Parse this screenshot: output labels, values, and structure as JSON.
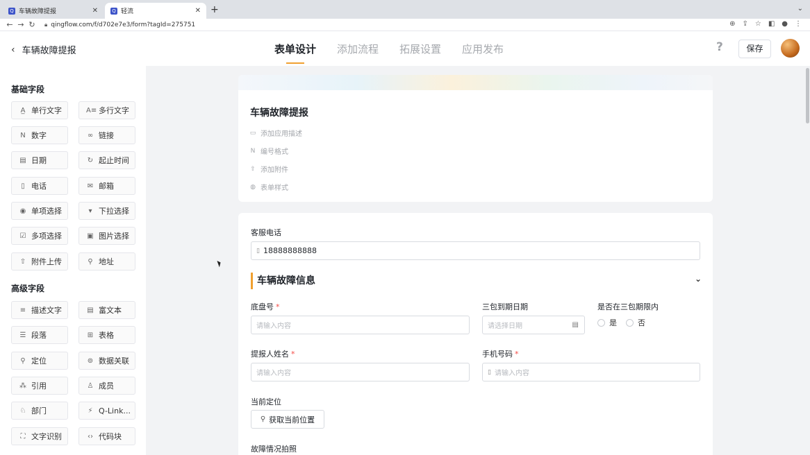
{
  "browser": {
    "tabs": [
      {
        "title": "车辆故障提报",
        "favicon": "Q",
        "active": false
      },
      {
        "title": "轻流",
        "favicon": "Q",
        "active": true
      }
    ],
    "url": "qingflow.com/f/d702e7e3/form?tagId=275751"
  },
  "header": {
    "back_label": "车辆故障提报",
    "tabs": [
      "表单设计",
      "添加流程",
      "拓展设置",
      "应用发布"
    ],
    "active_tab": "表单设计",
    "help": "?",
    "save_label": "保存"
  },
  "sidebar": {
    "basic_title": "基础字段",
    "basic_fields": [
      {
        "label": "单行文字",
        "icon": "single-line-text-icon",
        "glyph": "A̲"
      },
      {
        "label": "多行文字",
        "icon": "multi-line-text-icon",
        "glyph": "A≡"
      },
      {
        "label": "数字",
        "icon": "number-icon",
        "glyph": "N"
      },
      {
        "label": "链接",
        "icon": "link-icon",
        "glyph": "∞"
      },
      {
        "label": "日期",
        "icon": "date-icon",
        "glyph": "▤"
      },
      {
        "label": "起止时间",
        "icon": "time-range-icon",
        "glyph": "↻"
      },
      {
        "label": "电话",
        "icon": "phone-icon",
        "glyph": "▯"
      },
      {
        "label": "邮箱",
        "icon": "email-icon",
        "glyph": "✉"
      },
      {
        "label": "单项选择",
        "icon": "radio-icon",
        "glyph": "◉"
      },
      {
        "label": "下拉选择",
        "icon": "dropdown-icon",
        "glyph": "▾"
      },
      {
        "label": "多项选择",
        "icon": "checkbox-icon",
        "glyph": "☑"
      },
      {
        "label": "图片选择",
        "icon": "image-select-icon",
        "glyph": "▣"
      },
      {
        "label": "附件上传",
        "icon": "upload-icon",
        "glyph": "⇧"
      },
      {
        "label": "地址",
        "icon": "address-icon",
        "glyph": "⚲"
      }
    ],
    "advanced_title": "高级字段",
    "advanced_fields": [
      {
        "label": "描述文字",
        "icon": "description-icon",
        "glyph": "≡"
      },
      {
        "label": "富文本",
        "icon": "rich-text-icon",
        "glyph": "▤"
      },
      {
        "label": "段落",
        "icon": "paragraph-icon",
        "glyph": "☰"
      },
      {
        "label": "表格",
        "icon": "table-icon",
        "glyph": "⊞"
      },
      {
        "label": "定位",
        "icon": "location-icon",
        "glyph": "⚲"
      },
      {
        "label": "数据关联",
        "icon": "data-link-icon",
        "glyph": "⊚"
      },
      {
        "label": "引用",
        "icon": "reference-icon",
        "glyph": "⁂"
      },
      {
        "label": "成员",
        "icon": "member-icon",
        "glyph": "♙"
      },
      {
        "label": "部门",
        "icon": "department-icon",
        "glyph": "♘"
      },
      {
        "label": "Q-Link...",
        "icon": "q-link-icon",
        "glyph": "⚡"
      },
      {
        "label": "文字识别",
        "icon": "ocr-icon",
        "glyph": "⛶"
      },
      {
        "label": "代码块",
        "icon": "code-block-icon",
        "glyph": "‹›"
      }
    ]
  },
  "form_header": {
    "title": "车辆故障提报",
    "add_description": "添加应用描述",
    "number_format": "编号格式",
    "add_attachment": "添加附件",
    "form_style": "表单样式"
  },
  "form": {
    "service_phone_label": "客服电话",
    "service_phone_value": "18888888888",
    "section_title": "车辆故障信息",
    "chassis_label": "底盘号",
    "chassis_placeholder": "请输入内容",
    "warranty_date_label": "三包到期日期",
    "warranty_date_placeholder": "请选择日期",
    "in_warranty_label": "是否在三包期限内",
    "yes": "是",
    "no": "否",
    "reporter_label": "提报人姓名",
    "reporter_placeholder": "请输入内容",
    "phone_label": "手机号码",
    "phone_placeholder": "请输入内容",
    "location_label": "当前定位",
    "location_button": "获取当前位置",
    "photo_label": "故障情况拍照",
    "required_mark": "*"
  },
  "colors": {
    "accent": "#f0a030",
    "required": "#f54a45"
  }
}
